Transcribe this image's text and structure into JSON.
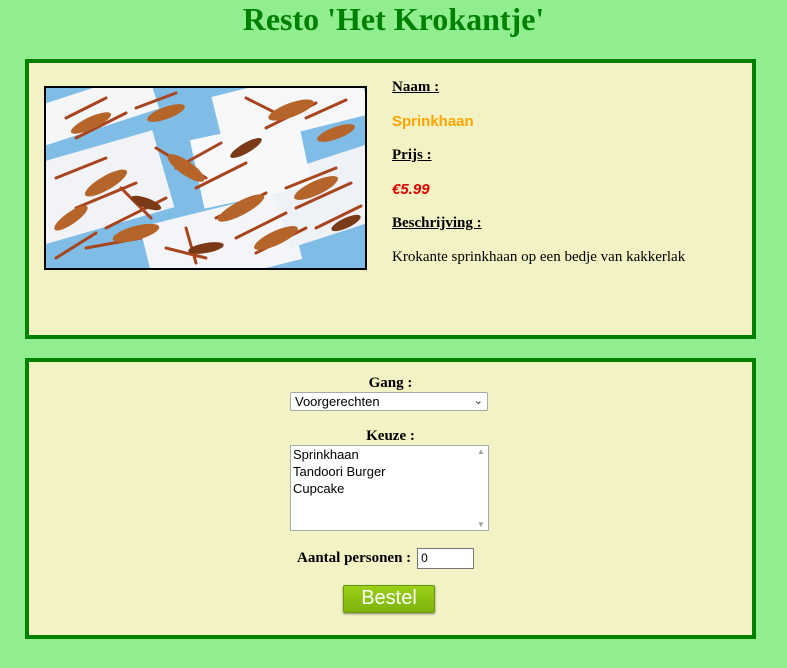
{
  "header": {
    "title": "Resto 'Het Krokantje'"
  },
  "product": {
    "image_icon": "fried-grasshoppers-photo",
    "name_label": "Naam :",
    "name": "Sprinkhaan",
    "price_label": "Prijs :",
    "price": "€5.99",
    "description_label": "Beschrijving :",
    "description": "Krokante sprinkhaan op een bedje van kakkerlak"
  },
  "order": {
    "course_label": "Gang :",
    "course_selected": "Voorgerechten",
    "choice_label": "Keuze :",
    "choice_options": [
      "Sprinkhaan",
      "Tandoori Burger",
      "Cupcake"
    ],
    "persons_label": "Aantal personen :",
    "persons_value": "0",
    "submit_label": "Bestel"
  },
  "colors": {
    "page_background": "#90ee90",
    "panel_background": "#f2f2c4",
    "panel_border": "#008000",
    "title": "#008000",
    "name": "#ffa500",
    "price": "#e00000",
    "button": "#8cc20f"
  }
}
